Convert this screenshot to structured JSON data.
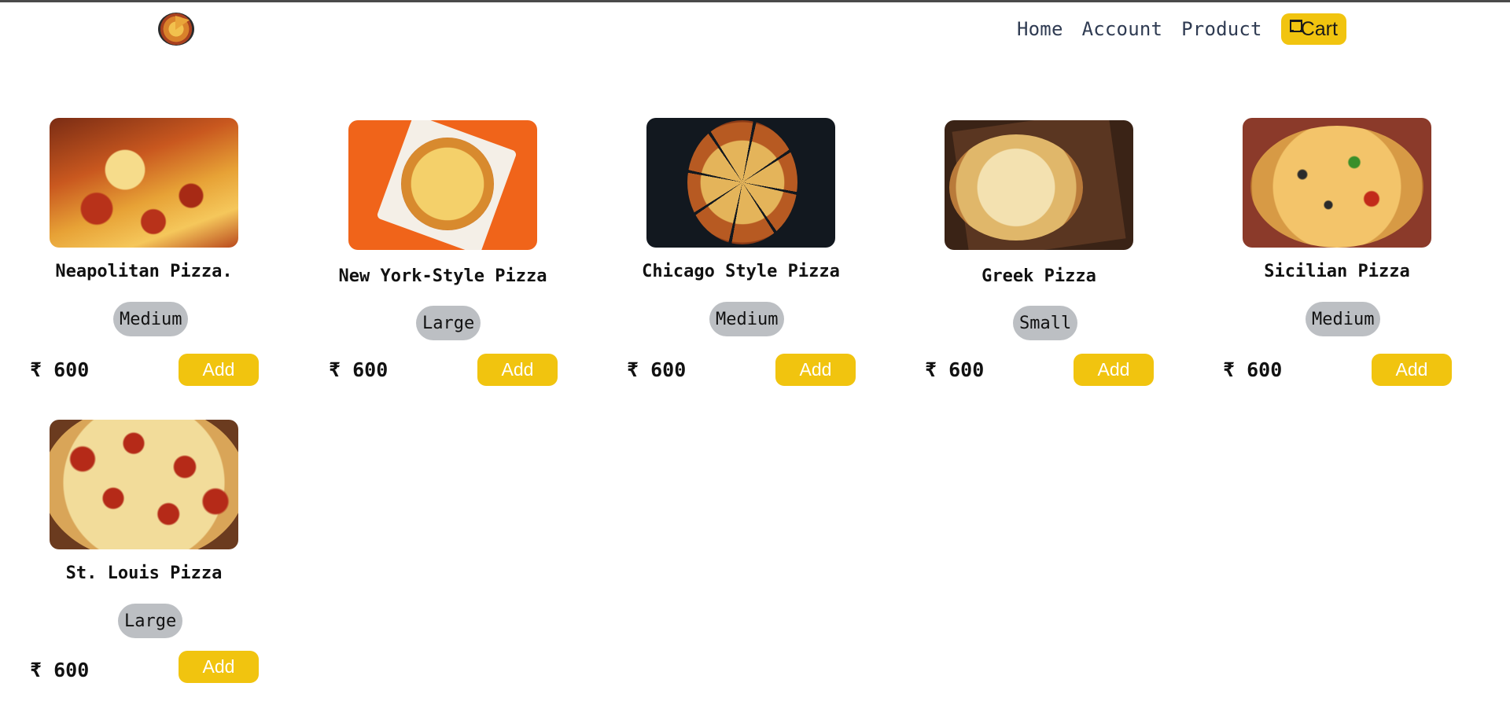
{
  "nav": {
    "logo_icon": "pizza-logo-icon",
    "links": [
      "Home",
      "Account",
      "Product"
    ],
    "cart_label": "Cart",
    "cart_icon": "cart-icon",
    "accent": "#f1c40f"
  },
  "products": [
    {
      "name": "Neapolitan Pizza.",
      "size": "Medium",
      "price": "₹ 600",
      "add_label": "Add"
    },
    {
      "name": "New York-Style Pizza",
      "size": "Large",
      "price": "₹ 600",
      "add_label": "Add"
    },
    {
      "name": "Chicago Style Pizza",
      "size": "Medium",
      "price": "₹ 600",
      "add_label": "Add"
    },
    {
      "name": "Greek Pizza",
      "size": "Small",
      "price": "₹ 600",
      "add_label": "Add"
    },
    {
      "name": "Sicilian Pizza",
      "size": "Medium",
      "price": "₹ 600",
      "add_label": "Add"
    },
    {
      "name": "St. Louis Pizza",
      "size": "Large",
      "price": "₹ 600",
      "add_label": "Add"
    }
  ]
}
